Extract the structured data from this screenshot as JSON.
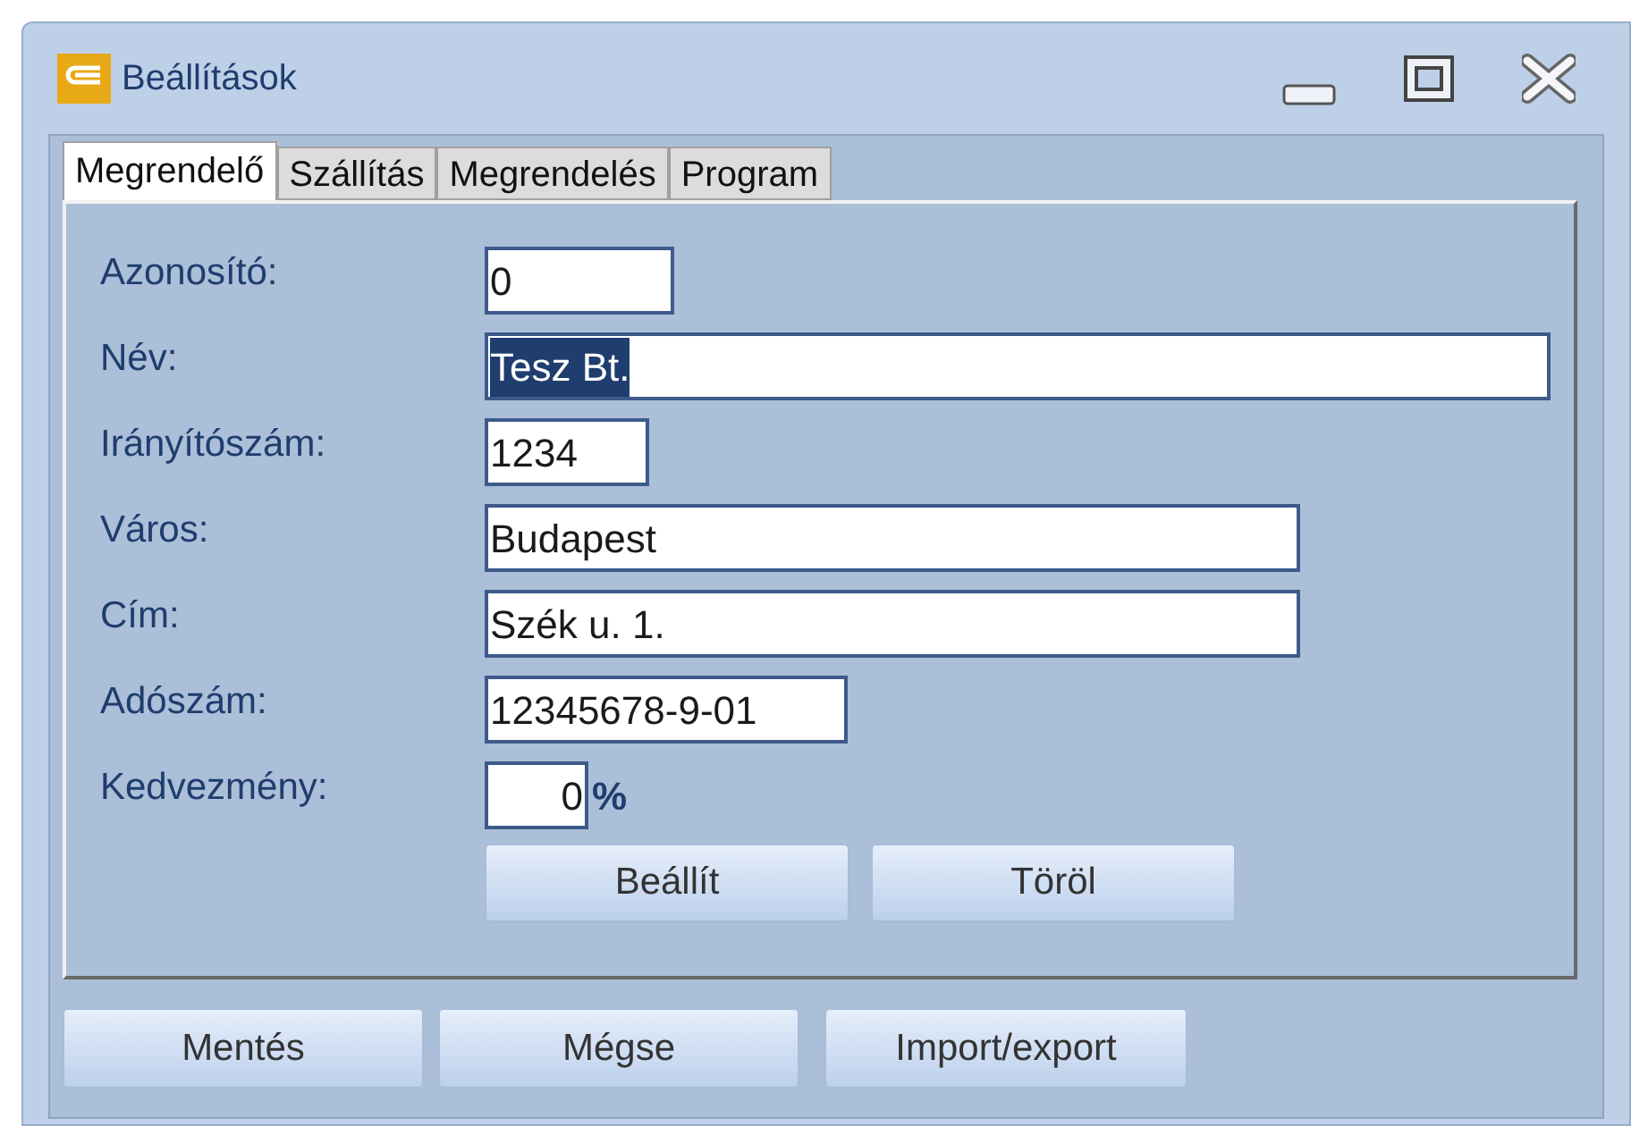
{
  "window": {
    "title": "Beállítások"
  },
  "tabs": [
    {
      "label": "Megrendelő",
      "selected": true
    },
    {
      "label": "Szállítás",
      "selected": false
    },
    {
      "label": "Megrendelés",
      "selected": false
    },
    {
      "label": "Program",
      "selected": false
    }
  ],
  "fields": [
    {
      "kind": "text",
      "label": "Azonosító:",
      "value": "0",
      "highlighted": false
    },
    {
      "kind": "text",
      "label": "Név:",
      "value": "Tesz Bt.",
      "highlighted": true
    },
    {
      "kind": "text",
      "label": "Irányítószám:",
      "value": "1234",
      "highlighted": false
    },
    {
      "kind": "text",
      "label": "Város:",
      "value": "Budapest",
      "highlighted": false
    },
    {
      "kind": "text",
      "label": "Cím:",
      "value": "Szék u. 1.",
      "highlighted": false
    },
    {
      "kind": "text",
      "label": "Adószám:",
      "value": "12345678-9-01",
      "highlighted": false
    },
    {
      "kind": "percent",
      "label": "Kedvezmény:",
      "value": "0",
      "suffix": "%",
      "highlighted": false
    }
  ],
  "panel_buttons": [
    "Beállít",
    "Töröl"
  ],
  "footer_buttons": [
    "Mentés",
    "Mégse",
    "Import/export"
  ]
}
